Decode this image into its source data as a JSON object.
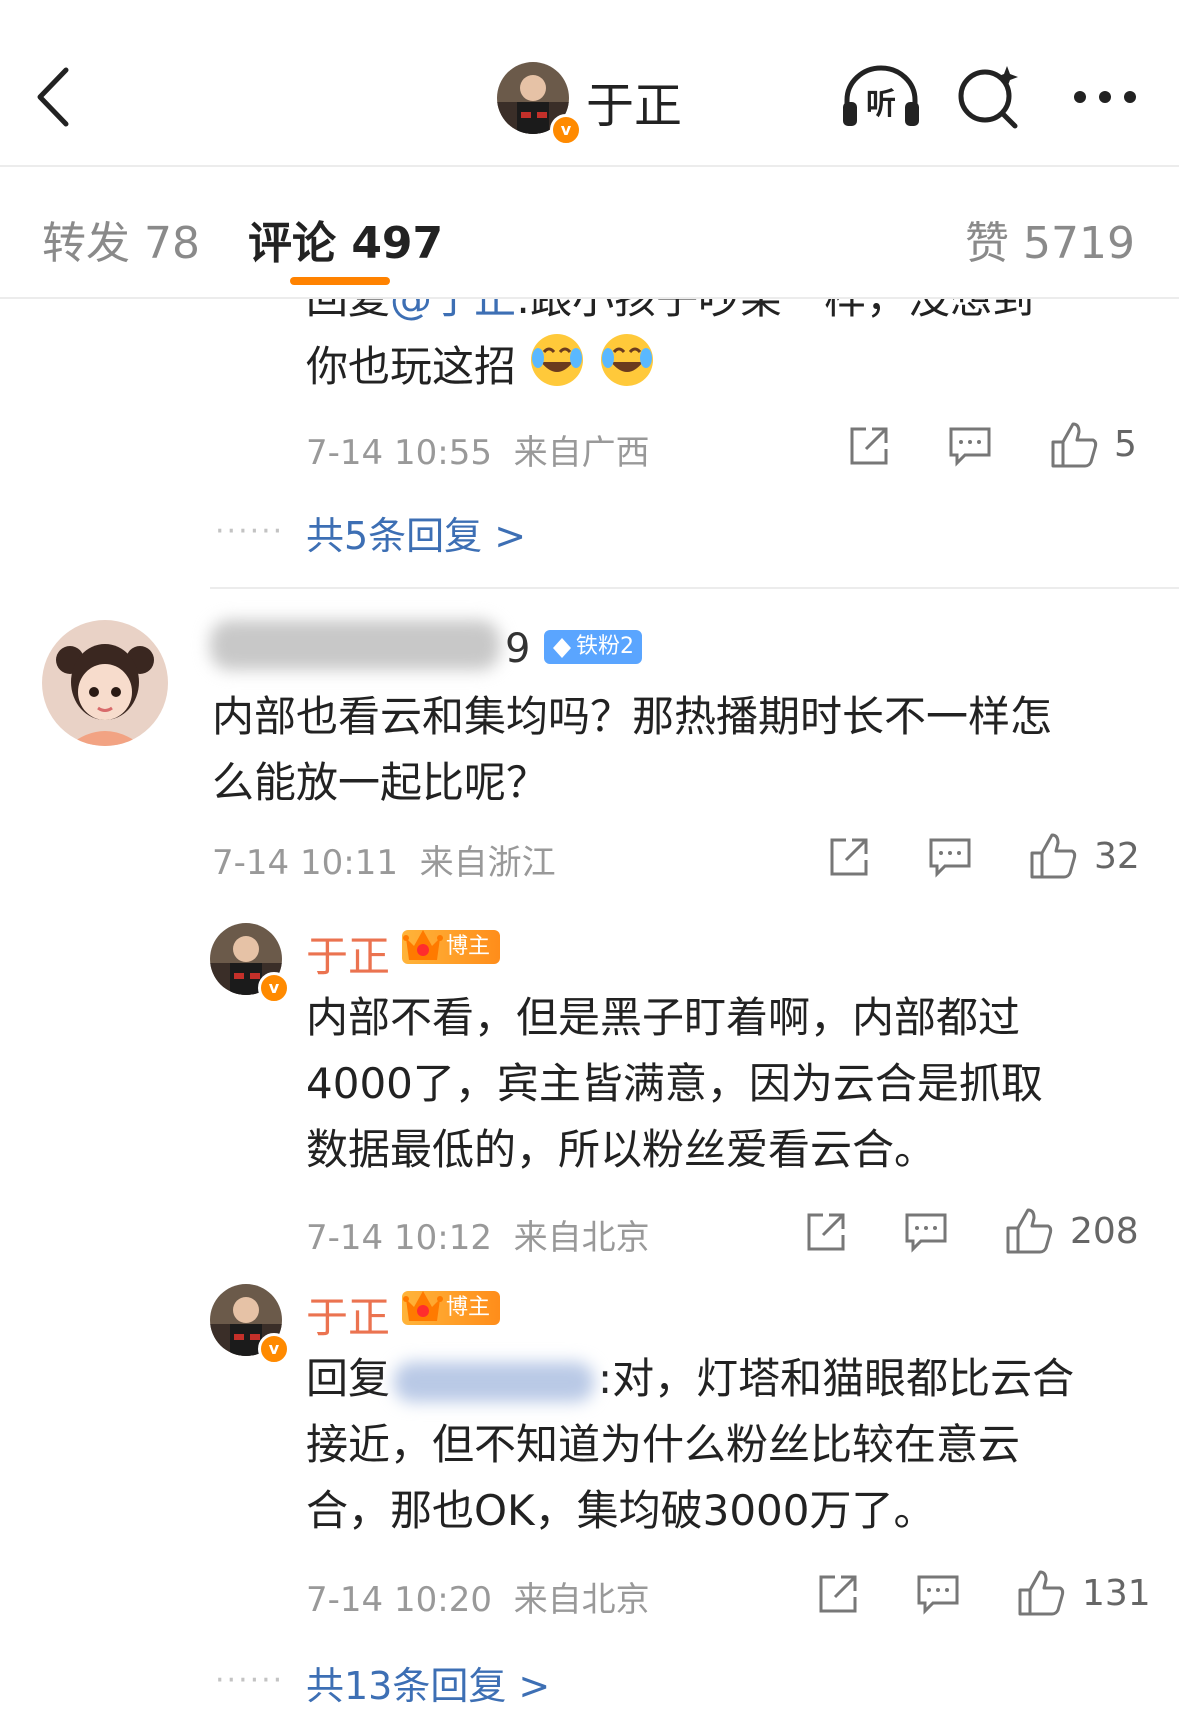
{
  "header": {
    "title": "于正",
    "listen_label": "听",
    "icons": [
      "back-arrow-icon",
      "headphones-icon",
      "ai-search-icon",
      "more-icon"
    ]
  },
  "tabs": {
    "repost": "转发 78",
    "comments": "评论 497",
    "likes": "赞 5719"
  },
  "top_partial": {
    "line1_prefix": "回复",
    "line1_mention": "@于正",
    "line1_rest": ":跟小孩子吵架一样，没想到",
    "line2": "你也玩这招",
    "time": "7-14 10:55",
    "location": "来自广西",
    "like_count": "5",
    "replies_link": "共5条回复 >"
  },
  "comment1": {
    "username_visible_tail": "9",
    "fan_badge": "铁粉2",
    "line1": "内部也看云和集均吗？那热播期时长不一样怎",
    "line2": "么能放一起比呢？",
    "time": "7-14 10:11",
    "location": "来自浙江",
    "like_count": "32"
  },
  "reply1": {
    "name": "于正",
    "badge": "博主",
    "line1": "内部不看，但是黑子盯着啊，内部都过",
    "line2": "4000了，宾主皆满意，因为云合是抓取",
    "line3": "数据最低的，所以粉丝爱看云合。",
    "time": "7-14 10:12",
    "location": "来自北京",
    "like_count": "208"
  },
  "reply2": {
    "name": "于正",
    "badge": "博主",
    "line1_prefix": "回复",
    "line1_rest": ":对，灯塔和猫眼都比云合",
    "line2": "接近，但不知道为什么粉丝比较在意云",
    "line3": "合，那也OK，集均破3000万了。",
    "time": "7-14 10:20",
    "location": "来自北京",
    "like_count": "131",
    "replies_link": "共13条回复 >"
  },
  "colors": {
    "accent": "#ff8200",
    "link": "#3d6fb4",
    "host_name": "#eb7350",
    "meta": "#999999"
  }
}
